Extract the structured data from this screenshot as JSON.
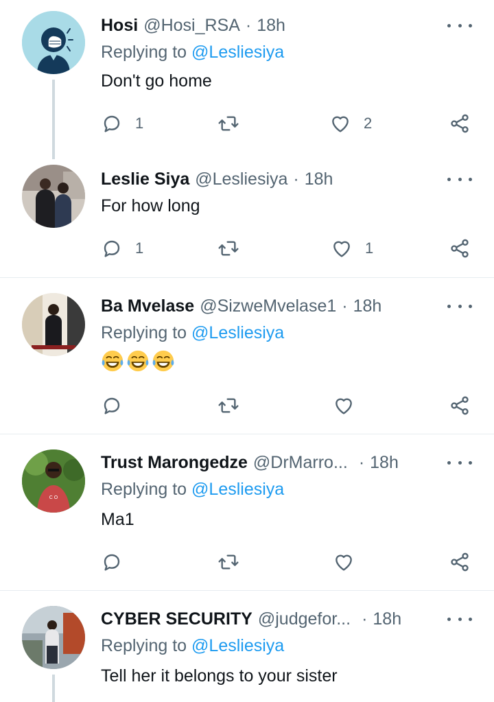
{
  "tweets": [
    {
      "name": "Hosi",
      "handle": "@Hosi_RSA",
      "dot": "·",
      "time": "18h",
      "reply_prefix": "Replying to",
      "reply_mention": "@Lesliesiya",
      "text": "Don't go home",
      "reply_count": "1",
      "like_count": "2"
    },
    {
      "name": "Leslie Siya",
      "handle": "@Lesliesiya",
      "dot": "·",
      "time": "18h",
      "text": "For how long",
      "reply_count": "1",
      "like_count": "1"
    },
    {
      "name": "Ba Mvelase",
      "handle": "@SizweMvelase1",
      "dot": "·",
      "time": "18h",
      "reply_prefix": "Replying to",
      "reply_mention": "@Lesliesiya",
      "emojis": [
        "face-with-tears-of-joy",
        "face-with-tears-of-joy",
        "face-with-tears-of-joy"
      ]
    },
    {
      "name": "Trust Marongedze",
      "handle": "@DrMarro...",
      "dot": "·",
      "time": "18h",
      "reply_prefix": "Replying to",
      "reply_mention": "@Lesliesiya",
      "text": "Ma1"
    },
    {
      "name": "CYBER SECURITY",
      "handle": "@judgefor...",
      "dot": "·",
      "time": "18h",
      "reply_prefix": "Replying to",
      "reply_mention": "@Lesliesiya",
      "text": "Tell her it belongs to your sister"
    }
  ],
  "icons": {
    "reply": "reply-icon",
    "retweet": "retweet-icon",
    "like": "heart-icon",
    "share": "share-icon",
    "more": "more-icon"
  },
  "colors": {
    "mention": "#1d9bf0",
    "secondary_text": "#536471",
    "thread_line": "#cfd9de",
    "divider": "#e6ecf0"
  }
}
